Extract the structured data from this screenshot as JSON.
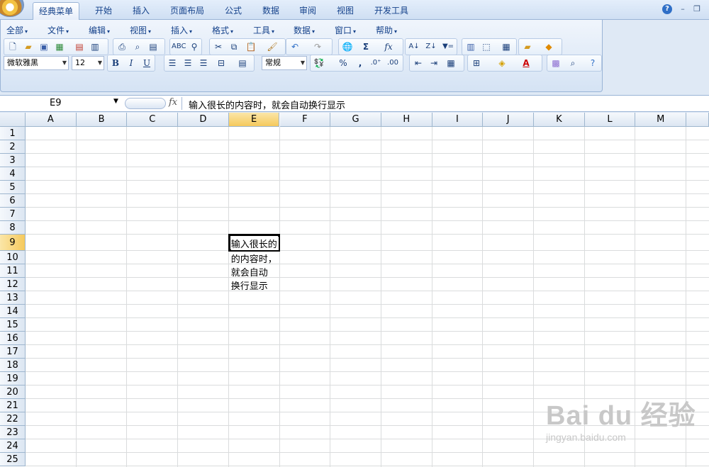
{
  "ribbon_tabs": [
    "经典菜单",
    "开始",
    "插入",
    "页面布局",
    "公式",
    "数据",
    "审阅",
    "视图",
    "开发工具"
  ],
  "active_tab": "经典菜单",
  "classic_menus": [
    "全部",
    "文件",
    "编辑",
    "视图",
    "插入",
    "格式",
    "工具",
    "数据",
    "窗口",
    "帮助"
  ],
  "toolbar": {
    "font_name": "微软雅黑",
    "font_size": "12",
    "bold": "B",
    "italic": "I",
    "underline": "U",
    "number_format": "常规",
    "percent": "%",
    "comma": ",",
    "sum": "Σ",
    "function": "fx"
  },
  "formula_bar": {
    "name_box": "E9",
    "fx_label": "fx",
    "content": "输入很长的内容时，就会自动换行显示"
  },
  "columns": [
    "A",
    "B",
    "C",
    "D",
    "E",
    "F",
    "G",
    "H",
    "I",
    "J",
    "K",
    "L",
    "M"
  ],
  "rows": [
    "1",
    "2",
    "3",
    "4",
    "5",
    "6",
    "7",
    "8",
    "9",
    "10",
    "11",
    "12",
    "13",
    "14",
    "15",
    "16",
    "17",
    "18",
    "19",
    "20",
    "21",
    "22",
    "23",
    "24",
    "25"
  ],
  "selected_cell": {
    "column": "E",
    "row": "9"
  },
  "cell_E9_lines": [
    "输入很长的",
    "的内容时，",
    "就会自动",
    "换行显示"
  ],
  "watermark": {
    "main": "Bai du 经验",
    "sub": "jingyan.baidu.com"
  },
  "colors": {
    "selection_header": "#f5c95c",
    "ribbon": "#dfe9f5",
    "gridline": "#dadcdd"
  }
}
